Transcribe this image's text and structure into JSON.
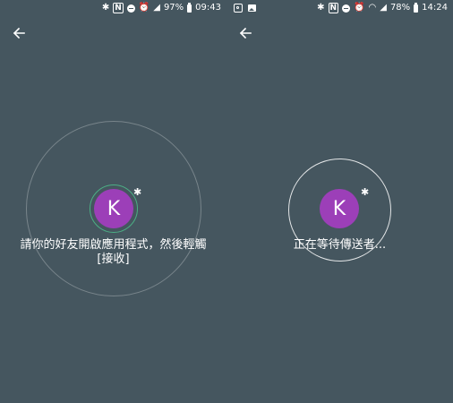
{
  "left": {
    "status": {
      "percent": "97%",
      "time": "09:43"
    },
    "avatar_initial": "K",
    "message_line1": "請你的好友開啟應用程式，然後輕觸",
    "message_line2": "[接收]"
  },
  "right": {
    "status": {
      "percent": "78%",
      "time": "14:24"
    },
    "avatar_initial": "K",
    "message": "正在等待傳送者..."
  },
  "icons": {
    "back": "arrow-left-icon",
    "bluetooth": "bluetooth-icon"
  },
  "colors": {
    "background": "#45565f",
    "avatar": "#9c3fb8",
    "ring_accent": "#4caf85"
  }
}
